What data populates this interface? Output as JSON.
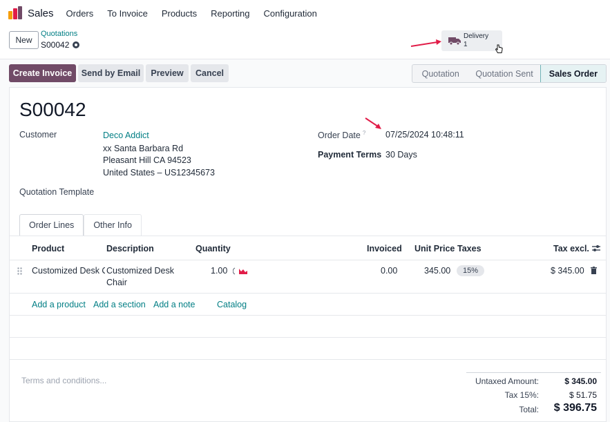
{
  "navbar": {
    "app_name": "Sales",
    "menu": [
      "Orders",
      "To Invoice",
      "Products",
      "Reporting",
      "Configuration"
    ]
  },
  "control_panel": {
    "new_label": "New",
    "breadcrumb_parent": "Quotations",
    "breadcrumb_current": "S00042",
    "smart_button": {
      "label": "Delivery",
      "value": "1",
      "icon": "truck-icon"
    }
  },
  "actions": {
    "buttons": [
      "Create Invoice",
      "Send by Email",
      "Preview",
      "Cancel"
    ],
    "stages": [
      "Quotation",
      "Quotation Sent",
      "Sales Order"
    ],
    "active_stage": "Sales Order"
  },
  "form": {
    "name": "S00042",
    "customer_label": "Customer",
    "customer_name": "Deco Addict",
    "address_line1": "xx Santa Barbara Rd",
    "address_line2": "Pleasant Hill CA 94523",
    "address_line3": "United States – US12345673",
    "quotation_template_label": "Quotation Template",
    "order_date_label": "Order Date",
    "order_date_help": "?",
    "order_date_value": "07/25/2024 10:48:11",
    "payment_terms_label": "Payment Terms",
    "payment_terms_value": "30 Days"
  },
  "tabs": [
    "Order Lines",
    "Other Info"
  ],
  "table": {
    "headers": {
      "product": "Product",
      "description": "Description",
      "quantity": "Quantity",
      "invoiced": "Invoiced",
      "unit_price": "Unit Price",
      "taxes": "Taxes",
      "tax_excl": "Tax excl."
    },
    "rows": [
      {
        "product": "Customized Desk C",
        "description_line1": "Customized Desk",
        "description_line2": "Chair",
        "quantity": "1.00",
        "invoiced": "0.00",
        "unit_price": "345.00",
        "tax": "15%",
        "subtotal": "$ 345.00"
      }
    ],
    "add_links": [
      "Add a product",
      "Add a section",
      "Add a note",
      "Catalog"
    ]
  },
  "footer": {
    "terms_placeholder": "Terms and conditions...",
    "untaxed_label": "Untaxed Amount:",
    "untaxed_value": "$ 345.00",
    "tax_label": "Tax 15%:",
    "tax_value": "$ 51.75",
    "total_label": "Total:",
    "total_value": "$ 396.75"
  },
  "colors": {
    "primary": "#714b67",
    "link": "#017e84",
    "annotation_arrow": "#e11d48"
  }
}
